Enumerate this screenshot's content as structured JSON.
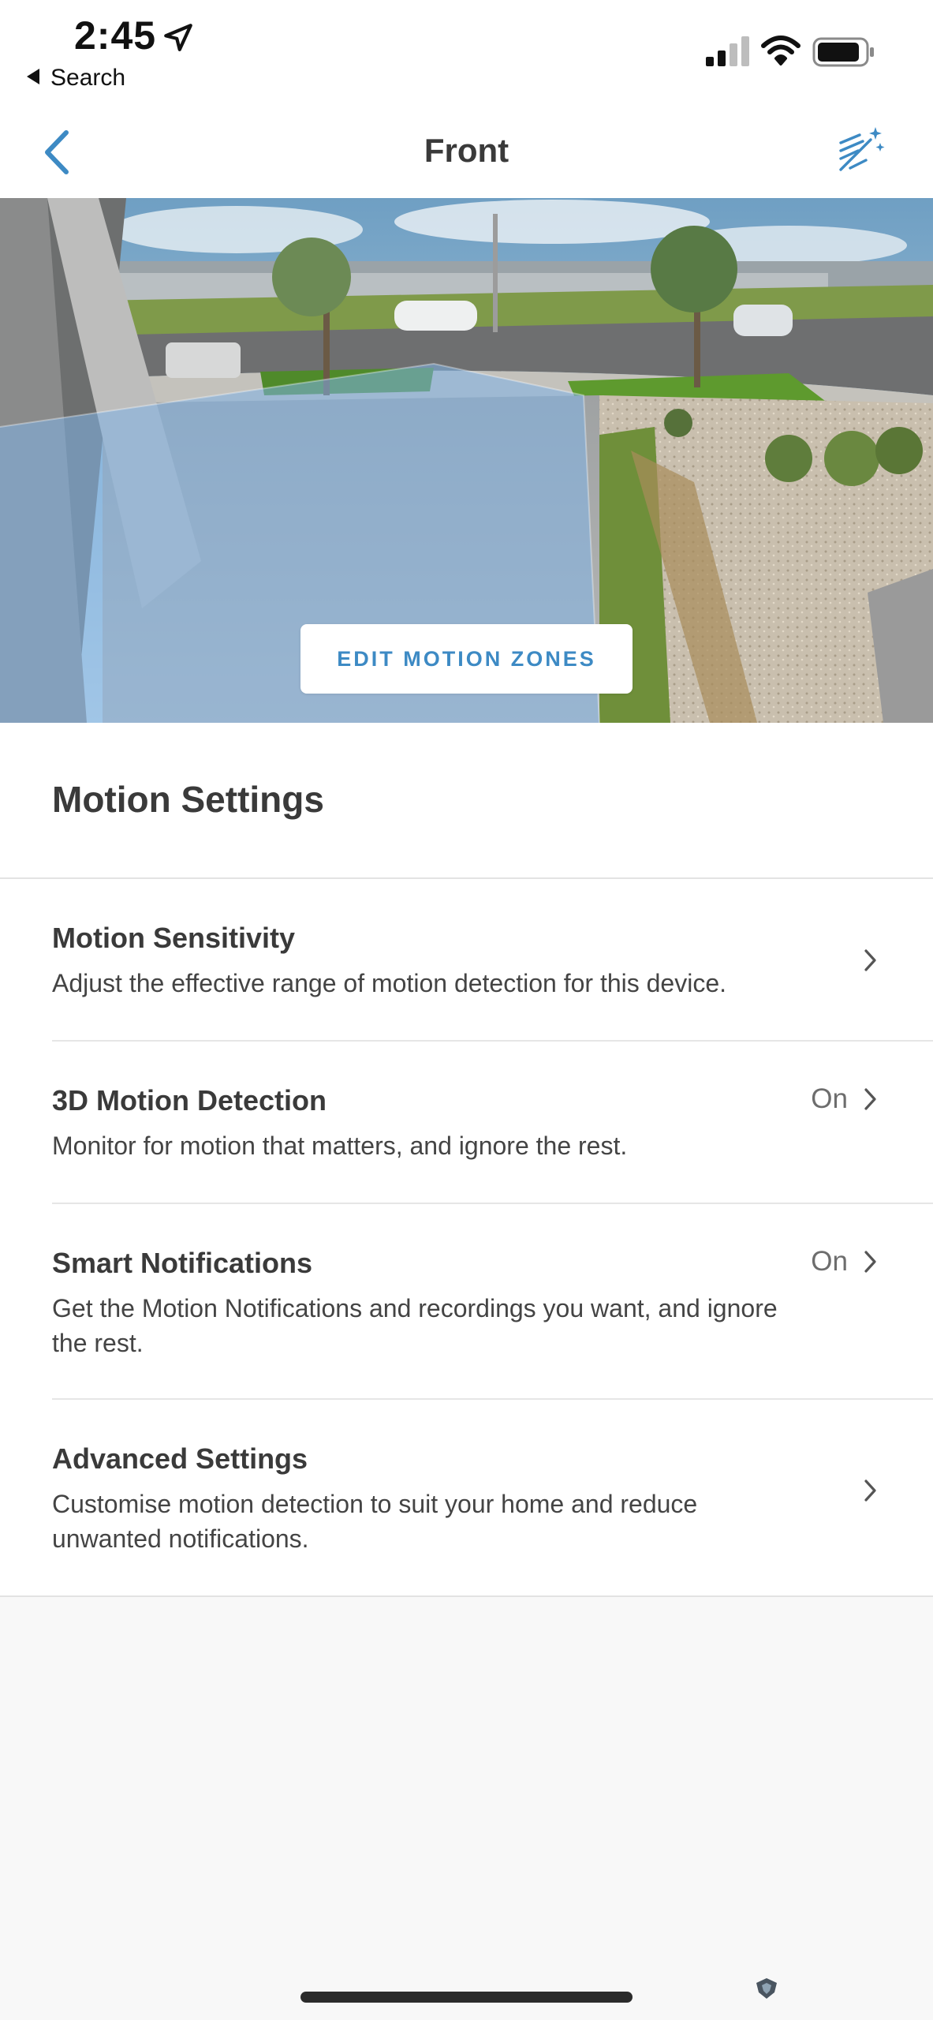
{
  "status_bar": {
    "time": "2:45",
    "back_label": "Search",
    "icons": [
      "location-arrow-icon",
      "cellular-signal-icon",
      "wifi-icon",
      "battery-icon"
    ]
  },
  "nav": {
    "title": "Front",
    "back_icon": "chevron-left-icon",
    "right_icon": "magic-wand-icon",
    "accent_color": "#3d8ac4"
  },
  "preview": {
    "edit_zones_label": "EDIT MOTION ZONES",
    "zone_overlay_color": "#7fb3e6"
  },
  "section": {
    "title": "Motion Settings"
  },
  "settings_items": [
    {
      "title": "Motion Sensitivity",
      "description": "Adjust the effective range of motion detection for this device.",
      "value": ""
    },
    {
      "title": "3D Motion Detection",
      "description": "Monitor for motion that matters, and ignore the rest.",
      "value": "On"
    },
    {
      "title": "Smart Notifications",
      "description": "Get the Motion Notifications and recordings you want, and ignore the rest.",
      "value": "On"
    },
    {
      "title": "Advanced Settings",
      "description": "Customise motion detection to suit your home and reduce unwanted notifications.",
      "value": ""
    }
  ]
}
